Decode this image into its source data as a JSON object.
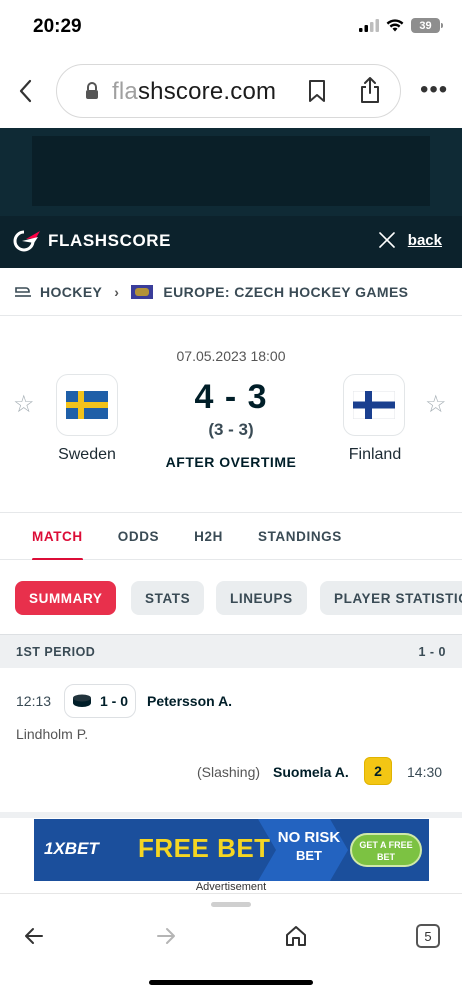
{
  "status_bar": {
    "time": "20:29",
    "battery": "39"
  },
  "browser": {
    "url_prefix": "fla",
    "url_main": "shscore.com",
    "back_icon": "chevron-left-icon",
    "tab_count": "5"
  },
  "header": {
    "logo_text": "FLASHSCORE",
    "back_label": "back"
  },
  "breadcrumb": {
    "sport": "HOCKEY",
    "competition": "EUROPE: CZECH HOCKEY GAMES"
  },
  "match": {
    "datetime": "07.05.2023 18:00",
    "home_team": "Sweden",
    "away_team": "Finland",
    "score": "4 - 3",
    "regulation_score": "(3 - 3)",
    "status": "AFTER OVERTIME"
  },
  "tabs": [
    "MATCH",
    "ODDS",
    "H2H",
    "STANDINGS"
  ],
  "subtabs": [
    "SUMMARY",
    "STATS",
    "LINEUPS",
    "PLAYER STATISTICS"
  ],
  "period": {
    "label": "1ST PERIOD",
    "score": "1 - 0"
  },
  "events": {
    "goal": {
      "time": "12:13",
      "score": "1 - 0",
      "scorer": "Petersson A.",
      "assist": "Lindholm P."
    },
    "penalty": {
      "reason": "(Slashing)",
      "player": "Suomela A.",
      "minutes": "2",
      "time": "14:30"
    }
  },
  "ad": {
    "brand": "1XBET",
    "headline": "FREE BET",
    "offer_line1": "NO RISK",
    "offer_line2": "BET",
    "cta": "GET A FREE BET",
    "label": "Advertisement"
  },
  "colors": {
    "accent": "#dc0d37",
    "header_bg": "#0c222c",
    "penalty_yellow": "#f3c614"
  }
}
